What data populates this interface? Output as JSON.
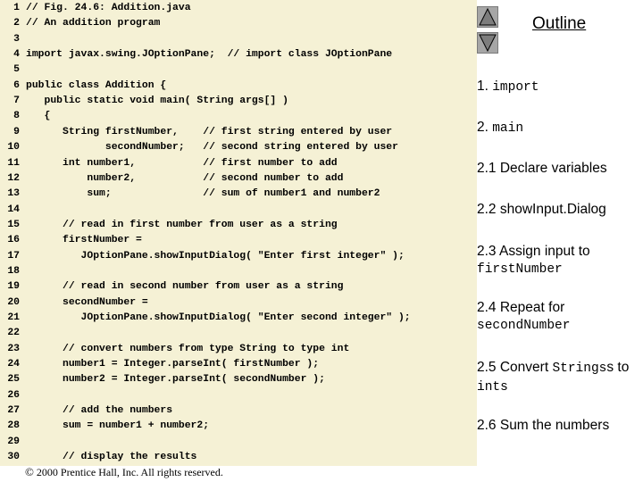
{
  "code_lines": [
    {
      "num": "1",
      "text": "// Fig. 24.6: Addition.java"
    },
    {
      "num": "2",
      "text": "// An addition program"
    },
    {
      "num": "3",
      "text": ""
    },
    {
      "num": "4",
      "text": "import javax.swing.JOptionPane;  // import class JOptionPane"
    },
    {
      "num": "5",
      "text": ""
    },
    {
      "num": "6",
      "text": "public class Addition {"
    },
    {
      "num": "7",
      "text": "   public static void main( String args[] )"
    },
    {
      "num": "8",
      "text": "   {"
    },
    {
      "num": "9",
      "text": "      String firstNumber,    // first string entered by user"
    },
    {
      "num": "10",
      "text": "             secondNumber;   // second string entered by user"
    },
    {
      "num": "11",
      "text": "      int number1,           // first number to add"
    },
    {
      "num": "12",
      "text": "          number2,           // second number to add"
    },
    {
      "num": "13",
      "text": "          sum;               // sum of number1 and number2"
    },
    {
      "num": "14",
      "text": ""
    },
    {
      "num": "15",
      "text": "      // read in first number from user as a string"
    },
    {
      "num": "16",
      "text": "      firstNumber ="
    },
    {
      "num": "17",
      "text": "         JOptionPane.showInputDialog( \"Enter first integer\" );"
    },
    {
      "num": "18",
      "text": ""
    },
    {
      "num": "19",
      "text": "      // read in second number from user as a string"
    },
    {
      "num": "20",
      "text": "      secondNumber ="
    },
    {
      "num": "21",
      "text": "         JOptionPane.showInputDialog( \"Enter second integer\" );"
    },
    {
      "num": "22",
      "text": ""
    },
    {
      "num": "23",
      "text": "      // convert numbers from type String to type int"
    },
    {
      "num": "24",
      "text": "      number1 = Integer.parseInt( firstNumber );"
    },
    {
      "num": "25",
      "text": "      number2 = Integer.parseInt( secondNumber );"
    },
    {
      "num": "26",
      "text": ""
    },
    {
      "num": "27",
      "text": "      // add the numbers"
    },
    {
      "num": "28",
      "text": "      sum = number1 + number2;"
    },
    {
      "num": "29",
      "text": ""
    },
    {
      "num": "30",
      "text": "      // display the results"
    }
  ],
  "copyright": {
    "symbol": "©",
    "text": " 2000 Prentice Hall, Inc.  All rights reserved."
  },
  "nav": {
    "up_icon": "triangle-up-icon",
    "down_icon": "triangle-down-icon"
  },
  "outline": {
    "title": "Outline",
    "items": [
      {
        "pre": "1. ",
        "mono": "import",
        "post": ""
      },
      {
        "pre": "2. ",
        "mono": "main",
        "post": ""
      },
      {
        "pre": "2.1 Declare variables",
        "mono": "",
        "post": ""
      },
      {
        "pre": "2.2 showInput.Dialog",
        "mono": "",
        "post": ""
      },
      {
        "pre": "2.3 Assign input to ",
        "mono": "firstNumber",
        "post": ""
      },
      {
        "pre": "2.4 Repeat for ",
        "mono": "secondNumber",
        "post": ""
      },
      {
        "pre": "2.5 Convert ",
        "mono": "Strings",
        "post": "s to ",
        "mono2": "ints"
      },
      {
        "pre": "2.6 Sum the numbers",
        "mono": "",
        "post": ""
      }
    ]
  },
  "colors": {
    "code_bg": "#f5f1d5",
    "button_gray": "#a6a6a6"
  }
}
